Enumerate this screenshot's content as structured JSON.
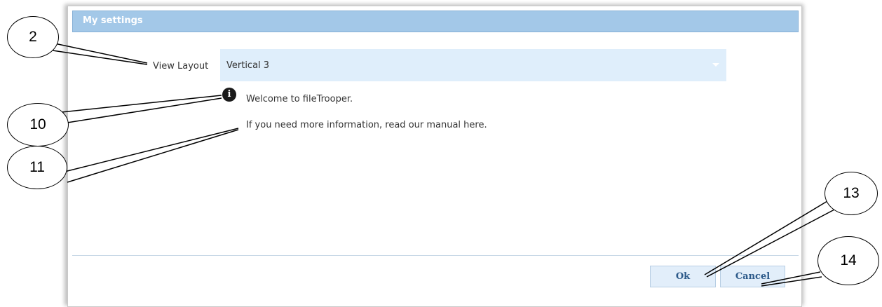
{
  "dialog": {
    "title": "My settings",
    "view_layout": {
      "label": "View Layout",
      "value": "Vertical 3"
    },
    "info": {
      "welcome": "Welcome to fileTrooper.",
      "manual": "If you need more information, read our manual here."
    },
    "buttons": {
      "ok": "Ok",
      "cancel": "Cancel"
    }
  },
  "callouts": [
    "2",
    "10",
    "11",
    "13",
    "14"
  ]
}
